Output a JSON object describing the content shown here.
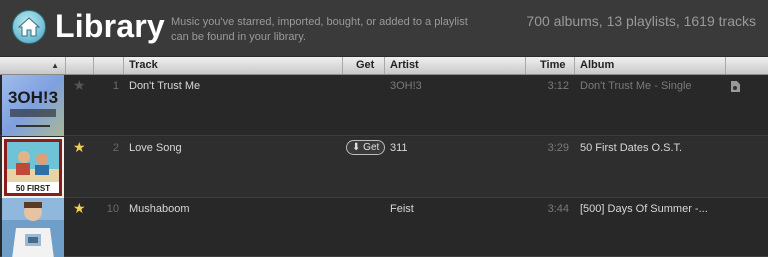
{
  "header": {
    "title": "Library",
    "description": "Music you've starred, imported, bought, or added to a playlist can be found in your library.",
    "stats": "700 albums, 13 playlists, 1619 tracks"
  },
  "columns": {
    "track": "Track",
    "get": "Get",
    "artist": "Artist",
    "time": "Time",
    "album": "Album"
  },
  "rows": [
    {
      "number": "1",
      "track": "Don't Trust Me",
      "artist": "3OH!3",
      "time": "3:12",
      "album": "Don't Trust Me - Single",
      "starred": false,
      "get_label": "",
      "art_text": "3OH!3",
      "available": false
    },
    {
      "number": "2",
      "track": "Love Song",
      "artist": "311",
      "time": "3:29",
      "album": "50 First Dates O.S.T.",
      "starred": true,
      "get_label": "Get",
      "art_text": "50 FIRST",
      "available": true
    },
    {
      "number": "10",
      "track": "Mushaboom",
      "artist": "Feist",
      "time": "3:44",
      "album": "[500] Days Of Summer -...",
      "starred": true,
      "get_label": "",
      "art_text": "",
      "available": true
    }
  ],
  "colors": {
    "star_on": "#f2d04a",
    "star_off": "#555555",
    "accent": "#7cc6d8"
  }
}
